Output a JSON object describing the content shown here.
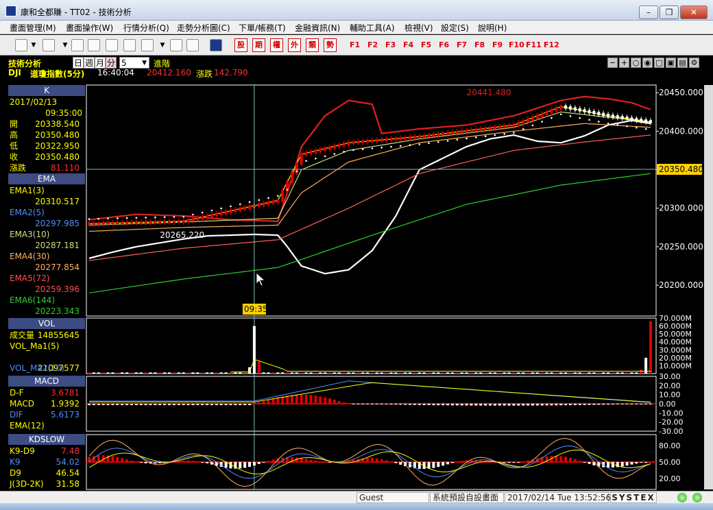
{
  "window": {
    "title": "康和全都賺 - TT02 - 技術分析"
  },
  "menu": [
    "畫面管理(M)",
    "畫面操作(W)",
    "行情分析(Q)",
    "走勢分析圖(C)",
    "下單/帳務(T)",
    "金融資訊(N)",
    "輔助工具(A)",
    "檢視(V)",
    "設定(S)",
    "說明(H)"
  ],
  "toolbar": {
    "tool_icons": [
      "chart-icon",
      "download-icon",
      "search-icon",
      "close-box-icon",
      "move-icon",
      "range-icon",
      "coin-icon",
      "print-icon",
      "screen-icon"
    ],
    "red_buttons": [
      "股",
      "期",
      "權",
      "外",
      "類",
      "勢"
    ],
    "fkeys": [
      "F1",
      "F2",
      "F3",
      "F4",
      "F5",
      "F6",
      "F7",
      "F8",
      "F9",
      "F10",
      "F11",
      "F12"
    ]
  },
  "info": {
    "section": "技術分析",
    "periods": [
      "日",
      "週",
      "月",
      "分"
    ],
    "active_period": "分",
    "interval": "5",
    "advanced": "進階",
    "symbol": "DJI",
    "symbol_name": "道瓊指數(5分)",
    "time": "16:40:04",
    "price": "20412.160",
    "change_label": "漲跌",
    "change": "142.790"
  },
  "panels": {
    "k": {
      "title": "K",
      "date": "2017/02/13",
      "time": "09:35:00",
      "rows": [
        {
          "label": "開",
          "value": "20338.540"
        },
        {
          "label": "高",
          "value": "20350.480"
        },
        {
          "label": "低",
          "value": "20322.950"
        },
        {
          "label": "收",
          "value": "20350.480"
        },
        {
          "label": "漲跌",
          "value": "81.110"
        }
      ]
    },
    "ema": {
      "title": "EMA",
      "rows": [
        {
          "label": "EMA1(3)",
          "value": "20310.517",
          "color": "#ffff00"
        },
        {
          "label": "EMA2(5)",
          "value": "20297.985",
          "color": "#4f8fff"
        },
        {
          "label": "EMA3(10)",
          "value": "20287.181",
          "color": "#c8e080"
        },
        {
          "label": "EMA4(30)",
          "value": "20277.854",
          "color": "#ffb060"
        },
        {
          "label": "EMA5(72)",
          "value": "20259.396",
          "color": "#ff5050"
        },
        {
          "label": "EMA6(144)",
          "value": "20223.343",
          "color": "#30d030"
        }
      ]
    },
    "vol": {
      "title": "VOL",
      "rows": [
        {
          "label": "成交量",
          "value": "14855645"
        },
        {
          "label": "VOL_Ma1(5)",
          "value": ""
        },
        {
          "label": "",
          "value": "21097577"
        },
        {
          "label": "VOL_Ma2(10)",
          "value": ""
        }
      ]
    },
    "macd": {
      "title": "MACD",
      "rows": [
        {
          "label": "D-F",
          "value": "3.6781"
        },
        {
          "label": "MACD",
          "value": "1.9392"
        },
        {
          "label": "DIF",
          "value": "5.6173"
        },
        {
          "label": "EMA(12)",
          "value": ""
        }
      ]
    },
    "kd": {
      "title": "KDSLOW",
      "rows": [
        {
          "label": "K9-D9",
          "value": "7.48"
        },
        {
          "label": "K9",
          "value": "54.02"
        },
        {
          "label": "D9",
          "value": "46.54"
        },
        {
          "label": "J(3D-2K)",
          "value": "31.58"
        }
      ]
    }
  },
  "chart_data": [
    {
      "type": "line",
      "panel": "price",
      "ylim": [
        20160,
        20460
      ],
      "y_ticks": [
        "20450.000",
        "20400.000",
        "20350.000",
        "20300.000",
        "20250.000",
        "20200.000"
      ],
      "y_tick_values": [
        20450,
        20400,
        20350,
        20300,
        20250,
        20200
      ],
      "crosshair_price": "20350.480",
      "crosshair_time": "09:35",
      "annotations": [
        {
          "text": "20441.480",
          "y": 20441.48
        },
        {
          "text": "20265.220",
          "y": 20265.22
        }
      ],
      "x_count": 120,
      "series": [
        {
          "color": "#ffffff",
          "values": [
            {
              "i": 0,
              "v": 20235
            },
            {
              "i": 5,
              "v": 20243
            },
            {
              "i": 10,
              "v": 20250
            },
            {
              "i": 15,
              "v": 20255
            },
            {
              "i": 20,
              "v": 20260
            },
            {
              "i": 25,
              "v": 20264
            },
            {
              "i": 30,
              "v": 20265
            },
            {
              "i": 35,
              "v": 20266
            },
            {
              "i": 40,
              "v": 20265
            },
            {
              "i": 42,
              "v": 20250
            },
            {
              "i": 45,
              "v": 20225
            },
            {
              "i": 50,
              "v": 20215
            },
            {
              "i": 55,
              "v": 20220
            },
            {
              "i": 60,
              "v": 20245
            },
            {
              "i": 65,
              "v": 20290
            },
            {
              "i": 70,
              "v": 20350
            },
            {
              "i": 75,
              "v": 20365
            },
            {
              "i": 80,
              "v": 20380
            },
            {
              "i": 85,
              "v": 20390
            },
            {
              "i": 90,
              "v": 20395
            },
            {
              "i": 95,
              "v": 20387
            },
            {
              "i": 100,
              "v": 20385
            },
            {
              "i": 105,
              "v": 20394
            },
            {
              "i": 110,
              "v": 20408
            },
            {
              "i": 115,
              "v": 20414
            },
            {
              "i": 119,
              "v": 20410
            }
          ]
        },
        {
          "color": "#e02020",
          "values": [
            {
              "i": 0,
              "v": 20285
            },
            {
              "i": 10,
              "v": 20292
            },
            {
              "i": 20,
              "v": 20290
            },
            {
              "i": 30,
              "v": 20285
            },
            {
              "i": 40,
              "v": 20283
            },
            {
              "i": 42,
              "v": 20320
            },
            {
              "i": 45,
              "v": 20380
            },
            {
              "i": 50,
              "v": 20420
            },
            {
              "i": 55,
              "v": 20440
            },
            {
              "i": 60,
              "v": 20435
            },
            {
              "i": 62,
              "v": 20397
            },
            {
              "i": 70,
              "v": 20403
            },
            {
              "i": 80,
              "v": 20408
            },
            {
              "i": 90,
              "v": 20420
            },
            {
              "i": 100,
              "v": 20440
            },
            {
              "i": 105,
              "v": 20445
            },
            {
              "i": 110,
              "v": 20442
            },
            {
              "i": 115,
              "v": 20437
            },
            {
              "i": 119,
              "v": 20428
            }
          ]
        },
        {
          "color": "#30d030",
          "values": [
            {
              "i": 0,
              "v": 20190
            },
            {
              "i": 20,
              "v": 20208
            },
            {
              "i": 40,
              "v": 20223
            },
            {
              "i": 60,
              "v": 20265
            },
            {
              "i": 80,
              "v": 20305
            },
            {
              "i": 100,
              "v": 20330
            },
            {
              "i": 119,
              "v": 20345
            }
          ]
        },
        {
          "color": "#ff6060",
          "values": [
            {
              "i": 0,
              "v": 20232
            },
            {
              "i": 20,
              "v": 20248
            },
            {
              "i": 40,
              "v": 20259
            },
            {
              "i": 55,
              "v": 20300
            },
            {
              "i": 70,
              "v": 20345
            },
            {
              "i": 90,
              "v": 20375
            },
            {
              "i": 105,
              "v": 20386
            },
            {
              "i": 119,
              "v": 20395
            }
          ]
        },
        {
          "color": "#ffb060",
          "values": [
            {
              "i": 0,
              "v": 20270
            },
            {
              "i": 20,
              "v": 20275
            },
            {
              "i": 40,
              "v": 20278
            },
            {
              "i": 45,
              "v": 20320
            },
            {
              "i": 55,
              "v": 20360
            },
            {
              "i": 70,
              "v": 20385
            },
            {
              "i": 90,
              "v": 20400
            },
            {
              "i": 105,
              "v": 20410
            },
            {
              "i": 119,
              "v": 20405
            }
          ]
        },
        {
          "color": "#c8e080",
          "values": [
            {
              "i": 0,
              "v": 20278
            },
            {
              "i": 20,
              "v": 20282
            },
            {
              "i": 40,
              "v": 20287
            },
            {
              "i": 45,
              "v": 20350
            },
            {
              "i": 55,
              "v": 20375
            },
            {
              "i": 70,
              "v": 20390
            },
            {
              "i": 90,
              "v": 20405
            },
            {
              "i": 100,
              "v": 20425
            },
            {
              "i": 110,
              "v": 20418
            },
            {
              "i": 119,
              "v": 20412
            }
          ]
        },
        {
          "color": "#ffff00",
          "values": [
            {
              "i": 0,
              "v": 20280
            },
            {
              "i": 20,
              "v": 20283
            },
            {
              "i": 40,
              "v": 20310
            },
            {
              "i": 45,
              "v": 20370
            },
            {
              "i": 55,
              "v": 20385
            },
            {
              "i": 70,
              "v": 20393
            },
            {
              "i": 90,
              "v": 20408
            },
            {
              "i": 100,
              "v": 20432
            },
            {
              "i": 110,
              "v": 20420
            },
            {
              "i": 119,
              "v": 20412
            }
          ]
        }
      ]
    },
    {
      "type": "bar",
      "panel": "volume",
      "ylim": [
        0,
        70
      ],
      "y_ticks": [
        "70.000M",
        "60.000M",
        "50.000M",
        "40.000M",
        "30.000M",
        "20.000M",
        "10.000M"
      ],
      "y_tick_values": [
        70,
        60,
        50,
        40,
        30,
        20,
        10
      ],
      "spikes": [
        {
          "i": 34,
          "v": 8
        },
        {
          "i": 35,
          "v": 60
        },
        {
          "i": 36,
          "v": 15
        },
        {
          "i": 117,
          "v": 5
        },
        {
          "i": 118,
          "v": 20
        },
        {
          "i": 119,
          "v": 66
        }
      ],
      "base_value": 1.5
    },
    {
      "type": "bar",
      "panel": "macd",
      "ylim": [
        -30,
        30
      ],
      "y_ticks": [
        "30.00",
        "20.00",
        "10.00",
        "0.00",
        "-10.00",
        "-20.00",
        "-30.00"
      ],
      "y_tick_values": [
        30,
        20,
        10,
        0,
        -10,
        -20,
        -30
      ]
    },
    {
      "type": "bar",
      "panel": "kd",
      "ylim": [
        0,
        100
      ],
      "y_ticks": [
        "80.00",
        "50.00",
        "20.00"
      ],
      "y_tick_values": [
        80,
        50,
        20
      ]
    }
  ],
  "status": {
    "user": "Guest",
    "screen": "系統預設自設畫面",
    "datetime": "2017/02/14 Tue 13:52:56",
    "brand": "SYSTEX"
  },
  "colors": {
    "panel_header": "#3d4c82",
    "up": "#e00000",
    "down": "#ffffff",
    "crosshair": "#7fbfbf"
  }
}
